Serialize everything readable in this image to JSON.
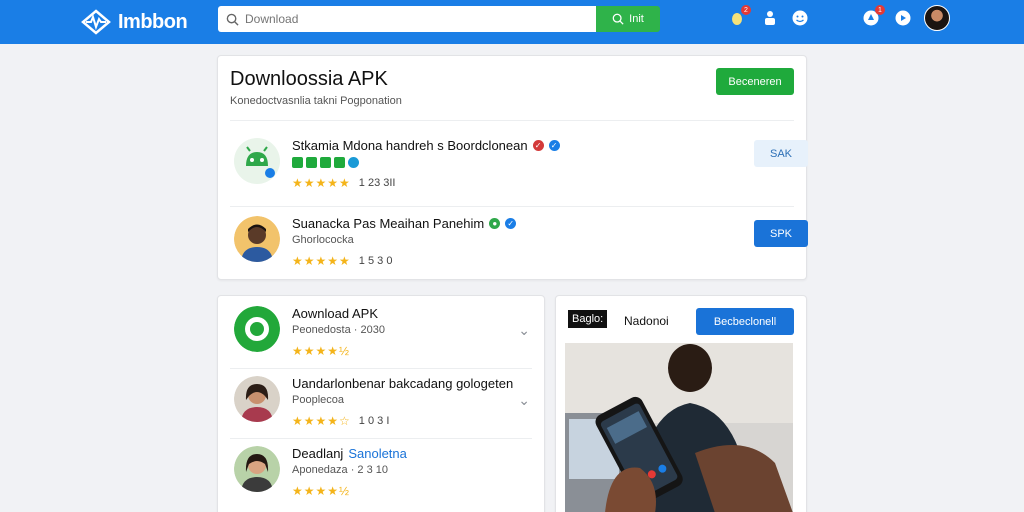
{
  "header": {
    "logo_text": "Imbbon",
    "search_placeholder": "Download",
    "search_button": "Init",
    "icons": [
      "notification-icon",
      "user-icon",
      "smiley-icon",
      "alerts-icon",
      "settings-icon"
    ],
    "badge_count_1": "2",
    "badge_count_2": "1"
  },
  "main_card": {
    "title": "Downloossia APK",
    "subtitle": "Konedoctvasnlia takni Pogponation",
    "action_button": "Beceneren",
    "apps": [
      {
        "name": "Stkamia Mdona handreh s Boordclonean",
        "rating_stars": "★★★★★",
        "rating_count": "1 23 3II",
        "button": "SAK"
      },
      {
        "name": "Suanacka Pas Meaihan Panehim",
        "sub": "Ghorlococka",
        "rating_stars": "★★★★★",
        "rating_count": "1 5 3 0",
        "button": "SPK"
      }
    ]
  },
  "list_card": {
    "items": [
      {
        "name": "Aownload APK",
        "sub": "Peonedosta · 2030",
        "rating_stars": "★★★★",
        "half": "½"
      },
      {
        "name": "Uandarlonbenar bakcadang gologeten",
        "sub": "Pooplecoa",
        "rating_stars": "★★★★",
        "half": "☆",
        "count": "1 0 3 I"
      },
      {
        "name": "Deadlanj",
        "name_blue": "Sanoletna",
        "sub": "Aponedaza · 2 3 10",
        "rating_stars": "★★★★",
        "half": "½"
      }
    ]
  },
  "promo_card": {
    "label": "Baglo:",
    "name": "Nadonoi",
    "button": "Becbeclonell"
  },
  "colors": {
    "topbar": "#1a7ee6",
    "green": "#1faa3c",
    "blue": "#1a73d8",
    "star": "#f4b41a"
  }
}
